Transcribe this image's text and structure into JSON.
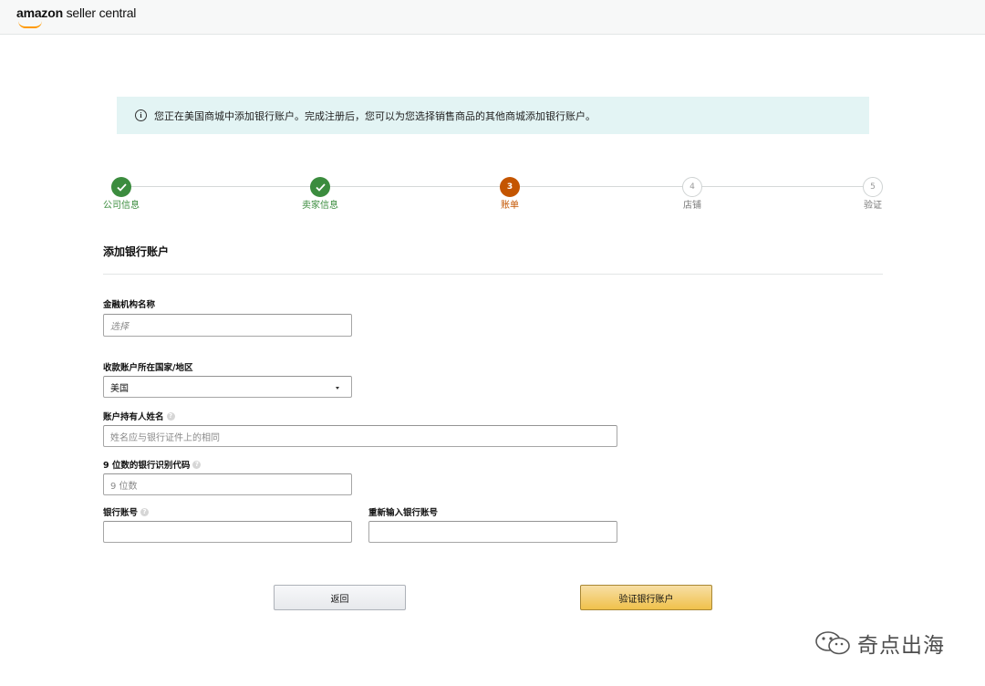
{
  "header": {
    "logo_brand": "amazon",
    "logo_rest": " seller central"
  },
  "banner": {
    "icon": "info-icon",
    "text": "您正在美国商城中添加银行账户。完成注册后，您可以为您选择销售商品的其他商城添加银行账户。"
  },
  "stepper": {
    "steps": [
      {
        "label": "公司信息",
        "state": "done",
        "mark": "✓"
      },
      {
        "label": "卖家信息",
        "state": "done",
        "mark": "✓"
      },
      {
        "label": "账单",
        "state": "current",
        "mark": "3"
      },
      {
        "label": "店铺",
        "state": "todo",
        "mark": "4"
      },
      {
        "label": "验证",
        "state": "todo",
        "mark": "5"
      }
    ]
  },
  "form": {
    "title": "添加银行账户",
    "institution": {
      "label": "金融机构名称",
      "placeholder": "选择"
    },
    "country": {
      "label": "收款账户所在国家/地区",
      "value": "美国"
    },
    "holder_name": {
      "label": "账户持有人姓名",
      "placeholder": "姓名应与银行证件上的相同"
    },
    "routing": {
      "label": "9 位数的银行识别代码",
      "placeholder": "9 位数"
    },
    "account_number": {
      "label": "银行账号",
      "value": ""
    },
    "account_number_confirm": {
      "label": "重新输入银行账号",
      "value": ""
    }
  },
  "actions": {
    "back_label": "返回",
    "verify_label": "验证银行账户"
  },
  "watermark": {
    "text": "奇点出海",
    "icon": "wechat-icon"
  },
  "colors": {
    "banner_bg": "#e3f4f4",
    "step_done": "#3b8c3e",
    "step_current": "#c45500",
    "button_primary": "#f0c14b"
  }
}
